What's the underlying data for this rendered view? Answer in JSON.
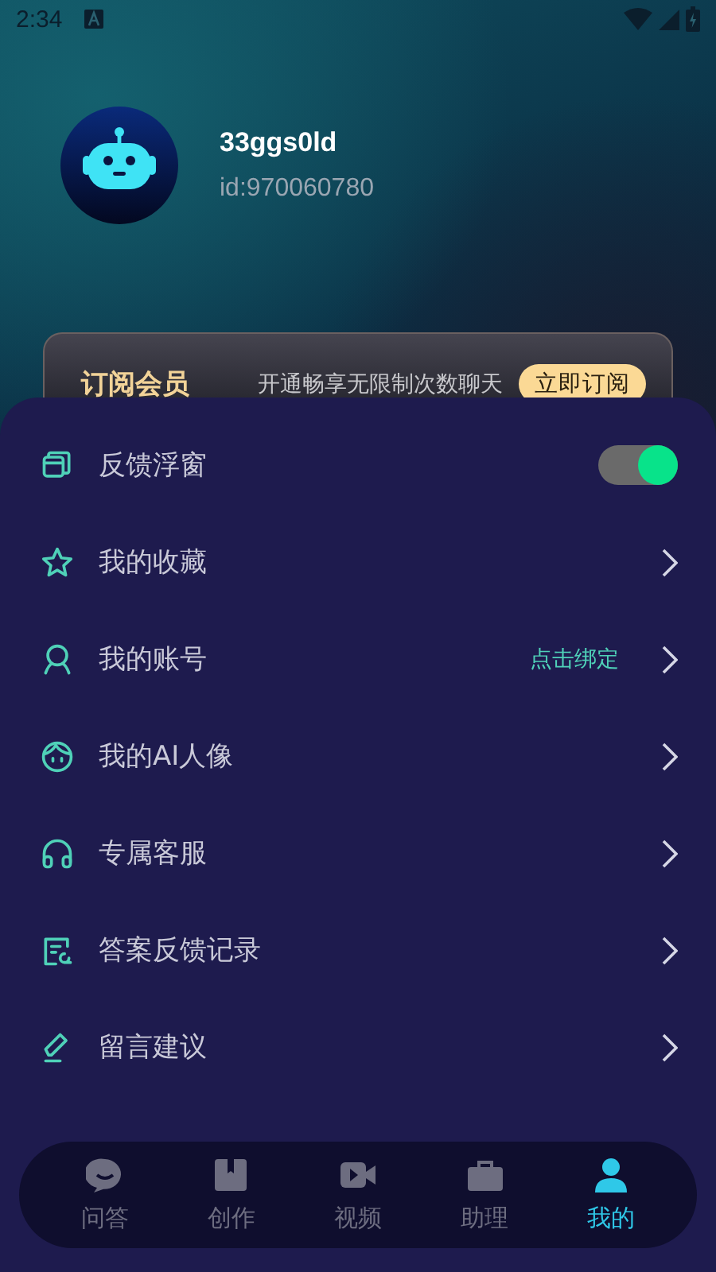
{
  "status_bar": {
    "time": "2:34"
  },
  "profile": {
    "name": "33ggs0ld",
    "id": "id:970060780"
  },
  "subscription": {
    "title": "订阅会员",
    "text": "开通畅享无限制次数聊天",
    "button": "立即订阅"
  },
  "menu": [
    {
      "kind": "toggle",
      "label": "反馈浮窗",
      "on": true
    },
    {
      "kind": "link",
      "label": "我的收藏"
    },
    {
      "kind": "link",
      "label": "我的账号",
      "value": "点击绑定"
    },
    {
      "kind": "link",
      "label": "我的AI人像"
    },
    {
      "kind": "link",
      "label": "专属客服"
    },
    {
      "kind": "link",
      "label": "答案反馈记录"
    },
    {
      "kind": "link",
      "label": "留言建议"
    }
  ],
  "tabs": [
    {
      "label": "问答",
      "selected": false
    },
    {
      "label": "创作",
      "selected": false
    },
    {
      "label": "视频",
      "selected": false
    },
    {
      "label": "助理",
      "selected": false
    },
    {
      "label": "我的",
      "selected": true
    }
  ]
}
